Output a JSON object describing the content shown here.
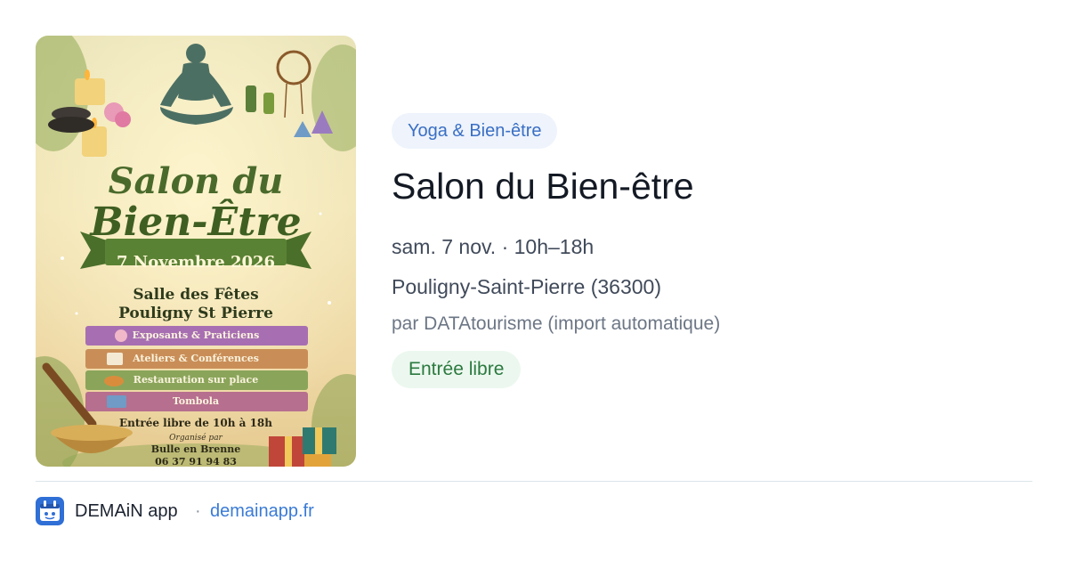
{
  "poster": {
    "title_line1": "Salon du",
    "title_line2": "Bien-Être",
    "date_banner": "7 Novembre 2026",
    "venue_line1": "Salle des Fêtes",
    "venue_line2": "Pouligny St Pierre",
    "features": [
      "Exposants & Praticiens",
      "Ateliers & Conférences",
      "Restauration sur place",
      "Tombola"
    ],
    "entry": "Entrée libre de 10h à 18h",
    "organizer_label": "Organisé par",
    "organizer_name": "Bulle en Brenne",
    "phone": "06 37 91 94 83"
  },
  "event": {
    "category": "Yoga & Bien-être",
    "title": "Salon du Bien-être",
    "datetime": "sam. 7 nov. · 10h–18h",
    "location": "Pouligny-Saint-Pierre (36300)",
    "source": "par DATAtourisme (import automatique)",
    "price_badge": "Entrée libre"
  },
  "footer": {
    "app_name": "DEMAiN app",
    "separator": "·",
    "url": "demainapp.fr"
  },
  "colors": {
    "accent_blue": "#3a7bd5",
    "category_bg": "#eef3fc",
    "free_badge_bg": "#ecf8ef",
    "free_badge_text": "#2c7a40"
  },
  "icons": [
    "demain-app-icon"
  ]
}
